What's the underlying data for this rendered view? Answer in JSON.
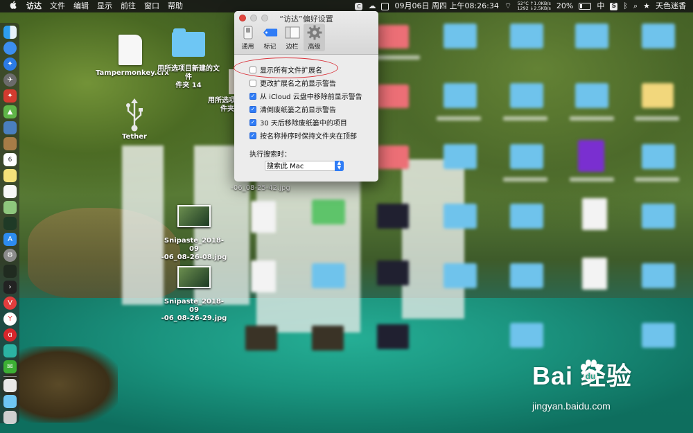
{
  "menubar": {
    "apple": "",
    "app": "访达",
    "menus": [
      "文件",
      "编辑",
      "显示",
      "前往",
      "窗口",
      "帮助"
    ],
    "right": {
      "clock": "09月06日 周四 上午08:26:34",
      "net_line1": "52°C ↑1.0KB/s",
      "net_line2": "1292 ↓2.5KB/s",
      "battery": "20%",
      "input_method": "中",
      "user": "天色迷香"
    }
  },
  "window": {
    "title": "“访达”偏好设置",
    "tabs": [
      {
        "label": "通用",
        "icon": "general-switch-icon"
      },
      {
        "label": "标记",
        "icon": "tag-icon"
      },
      {
        "label": "边栏",
        "icon": "sidebar-icon"
      },
      {
        "label": "高级",
        "icon": "gear-icon",
        "active": true
      }
    ],
    "options": [
      {
        "label": "显示所有文件扩展名",
        "checked": false
      },
      {
        "label": "更改扩展名之前显示警告",
        "checked": false
      },
      {
        "label": "从 iCloud 云盘中移除前显示警告",
        "checked": true
      },
      {
        "label": "清倒废纸篓之前显示警告",
        "checked": true
      },
      {
        "label": "30 天后移除废纸篓中的项目",
        "checked": true
      },
      {
        "label": "按名称排序时保持文件夹在顶部",
        "checked": true
      }
    ],
    "search_label": "执行搜索时：",
    "search_select": "搜索此 Mac"
  },
  "desktop": {
    "tampermonkey": "Tampermonkey.crx",
    "folder1_l1": "用所选项目新建的文件",
    "folder1_l2": "件夹 14",
    "folder2_l1": "用所选项目",
    "folder2_l2": "件夹",
    "tether": "Tether",
    "snip1_l1": "Snipaste_2018-09",
    "snip1_l2": "-06_08-26-08.jpg",
    "snip2_l1": "Snipaste_2018-09",
    "snip2_l2": "-06_08-26-29.jpg",
    "snip3_l2": "-06_08-25-42.jpg"
  },
  "watermark": {
    "logo": "Bai  经验",
    "url": "jingyan.baidu.com"
  },
  "colors": {
    "accent": "#2f7cf6",
    "annotation": "#d9323a",
    "folder": "#6ec6f4"
  }
}
